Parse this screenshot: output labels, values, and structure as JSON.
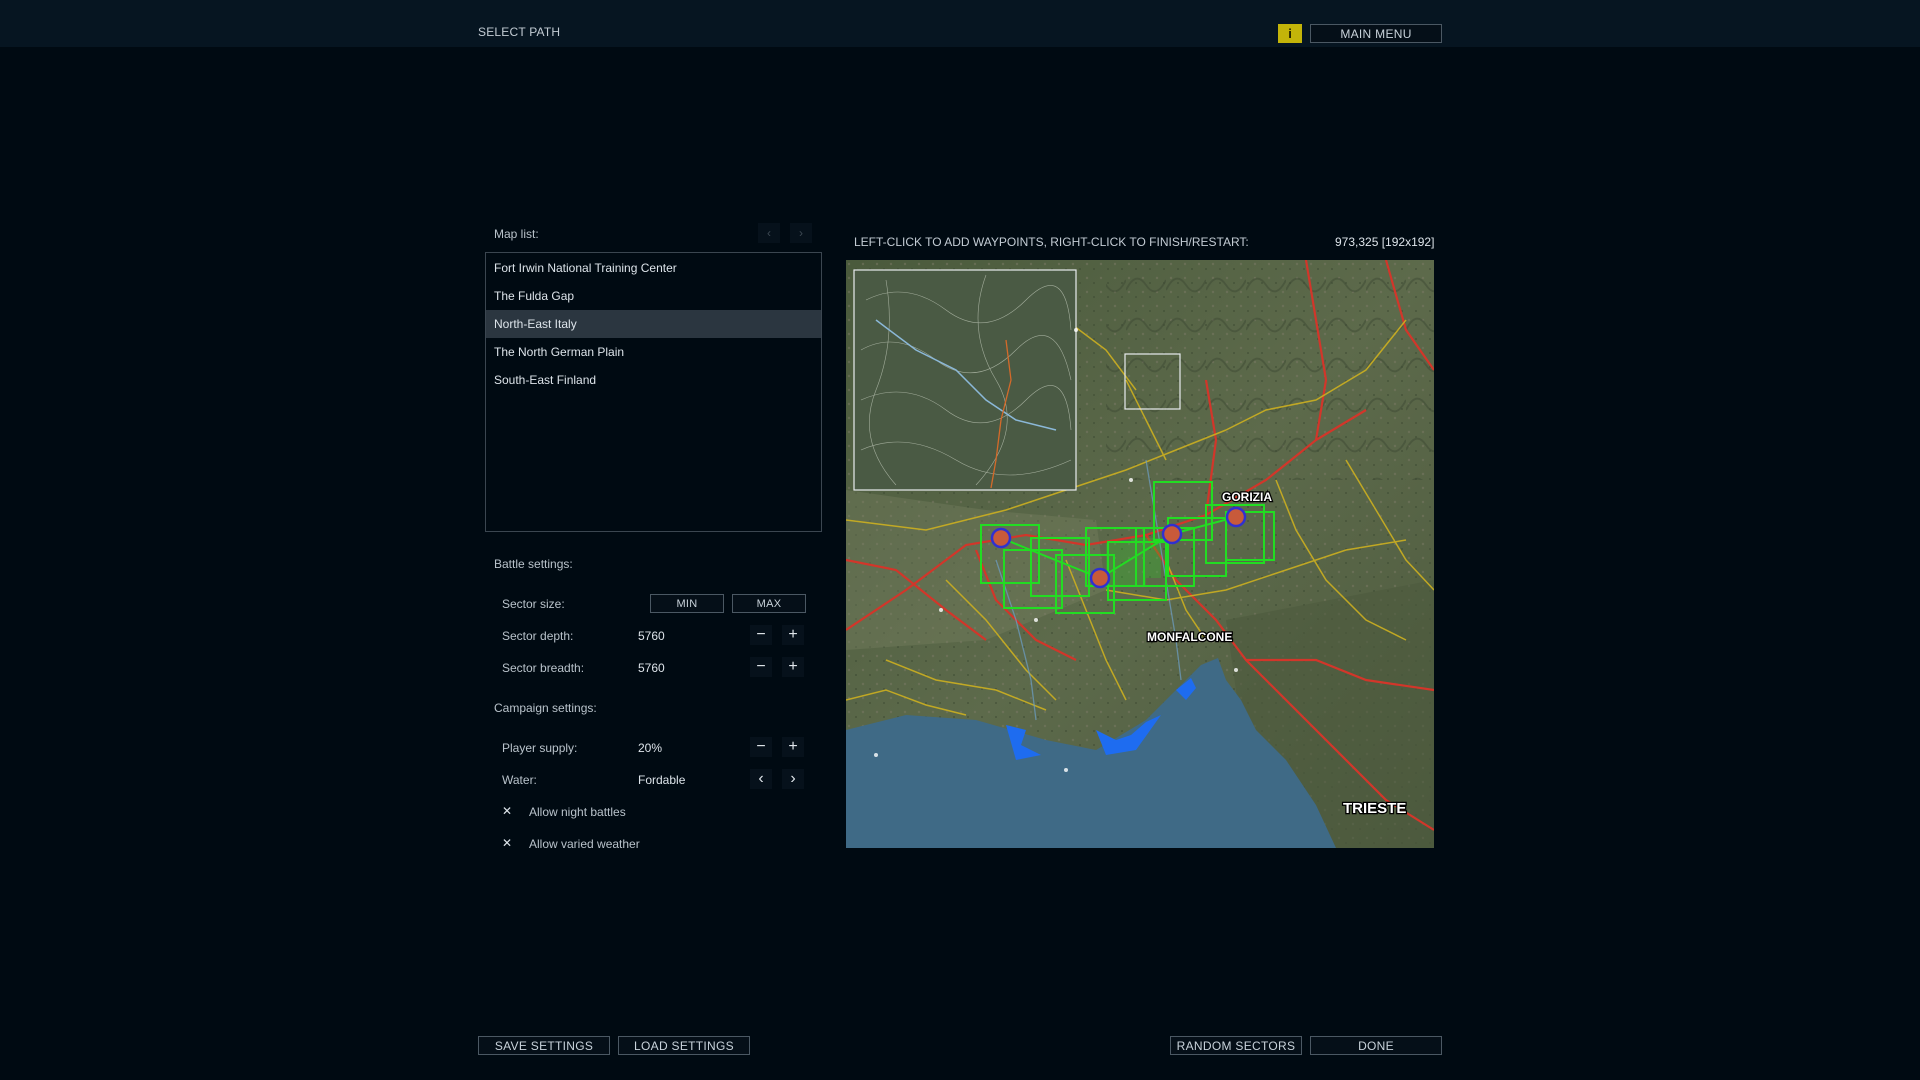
{
  "header": {
    "title": "SELECT PATH",
    "info_glyph": "i",
    "main_menu_label": "MAIN MENU"
  },
  "map_list": {
    "label": "Map list:",
    "prev_glyph": "‹",
    "next_glyph": "›",
    "items": [
      {
        "label": "Fort Irwin National Training Center",
        "selected": false
      },
      {
        "label": "The Fulda Gap",
        "selected": false
      },
      {
        "label": "North-East Italy",
        "selected": true
      },
      {
        "label": "The North German Plain",
        "selected": false
      },
      {
        "label": "South-East Finland",
        "selected": false
      }
    ]
  },
  "battle_settings": {
    "label": "Battle settings:",
    "sector_size_label": "Sector size:",
    "min_label": "MIN",
    "max_label": "MAX",
    "sector_depth_label": "Sector depth:",
    "sector_depth_value": "5760",
    "sector_breadth_label": "Sector breadth:",
    "sector_breadth_value": "5760"
  },
  "campaign_settings": {
    "label": "Campaign settings:",
    "player_supply_label": "Player supply:",
    "player_supply_value": "20%",
    "water_label": "Water:",
    "water_value": "Fordable",
    "night_battles_label": "Allow night battles",
    "night_battles_checked": true,
    "varied_weather_label": "Allow varied weather",
    "varied_weather_checked": true
  },
  "map_panel": {
    "instruction": "LEFT-CLICK TO ADD WAYPOINTS, RIGHT-CLICK TO FINISH/RESTART:",
    "coordinates": "973,325 [192x192]",
    "places": {
      "gorizia": "GORIZIA",
      "monfalcone": "MONFALCONE",
      "trieste": "TRIESTE"
    }
  },
  "footer": {
    "save_label": "SAVE SETTINGS",
    "load_label": "LOAD SETTINGS",
    "random_label": "RANDOM SECTORS",
    "done_label": "DONE"
  },
  "glyphs": {
    "minus": "−",
    "plus": "+",
    "left": "‹",
    "right": "›",
    "check": "✕"
  },
  "colors": {
    "background": "#000a12",
    "accent_yellow": "#c3b409",
    "sector_green": "#22dd22",
    "waypoint_blue": "#3030d0",
    "sea": "#3f6a86"
  }
}
